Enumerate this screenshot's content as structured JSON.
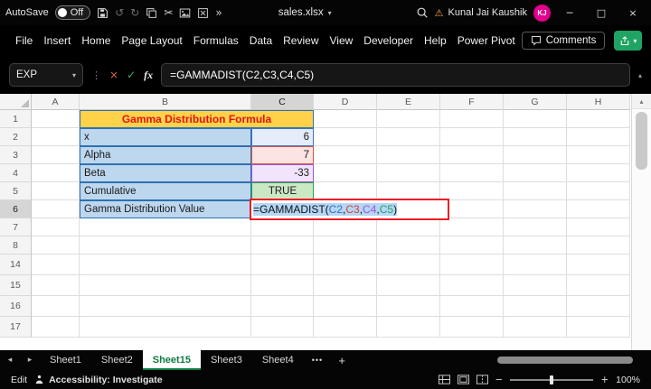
{
  "colors": {
    "excel_green": "#107C41",
    "avatar_pink": "#E3008C",
    "title_fill_yellow": "#FFD24A",
    "title_text_red": "#E11414",
    "label_fill_blue": "#BDD7EE",
    "ref_blue": "#2E75B6",
    "ref_red": "#DF3B32",
    "ref_purple": "#9C57D4",
    "ref_green": "#21A366",
    "edit_border_red": "#EE1C25"
  },
  "glyphs": {
    "caret_down": "▾",
    "caret_up": "▴",
    "undo": "↺",
    "redo": "↻",
    "scissors": "✂",
    "overflow_chevrons": "»",
    "minimize": "─",
    "maximize": "□",
    "close": "×",
    "cancel": "×",
    "confirm": "✓",
    "fx": "fx",
    "warning": "⚠",
    "dots": "⋮",
    "tab_overflow": "•••",
    "add": "+",
    "nav_left": "◂",
    "nav_right": "▸",
    "scroll_up": "▲",
    "zoom_out": "−",
    "zoom_in": "+"
  },
  "title_bar": {
    "autosave_label": "AutoSave",
    "autosave_state": "Off",
    "filename": "sales.xlsx",
    "user_name": "Kunal Jai Kaushik",
    "user_initials": "KJ"
  },
  "menu_bar": {
    "items": [
      "File",
      "Insert",
      "Home",
      "Page Layout",
      "Formulas",
      "Data",
      "Review",
      "View",
      "Developer",
      "Help",
      "Power Pivot"
    ],
    "comments_label": "Comments"
  },
  "formula_bar": {
    "name_box_value": "EXP",
    "formula": "=GAMMADIST(C2,C3,C4,C5)"
  },
  "sheet": {
    "column_headers": [
      "A",
      "B",
      "C",
      "D",
      "E",
      "F",
      "G",
      "H"
    ],
    "row_headers": [
      "1",
      "2",
      "3",
      "4",
      "5",
      "6",
      "7",
      "8",
      "14",
      "15",
      "16",
      "17"
    ],
    "cells": {
      "title": "Gamma Distribution Formula",
      "b2": "x",
      "c2": "6",
      "b3": "Alpha",
      "c3": "7",
      "b4": "Beta",
      "c4": "-33",
      "b5": "Cumulative",
      "c5": "TRUE",
      "b6": "Gamma Distribution Value"
    },
    "edit_formula": {
      "prefix": "=GAMMADIST(",
      "ref1": "C2",
      "ref2": "C3",
      "ref3": "C4",
      "ref4": "C5",
      "comma": ",",
      "suffix": ")"
    }
  },
  "tab_bar": {
    "tabs": [
      "Sheet1",
      "Sheet2",
      "Sheet15",
      "Sheet3",
      "Sheet4"
    ],
    "active_tab": "Sheet15"
  },
  "status_bar": {
    "mode": "Edit",
    "accessibility": "Accessibility: Investigate",
    "zoom_level": "100%"
  }
}
